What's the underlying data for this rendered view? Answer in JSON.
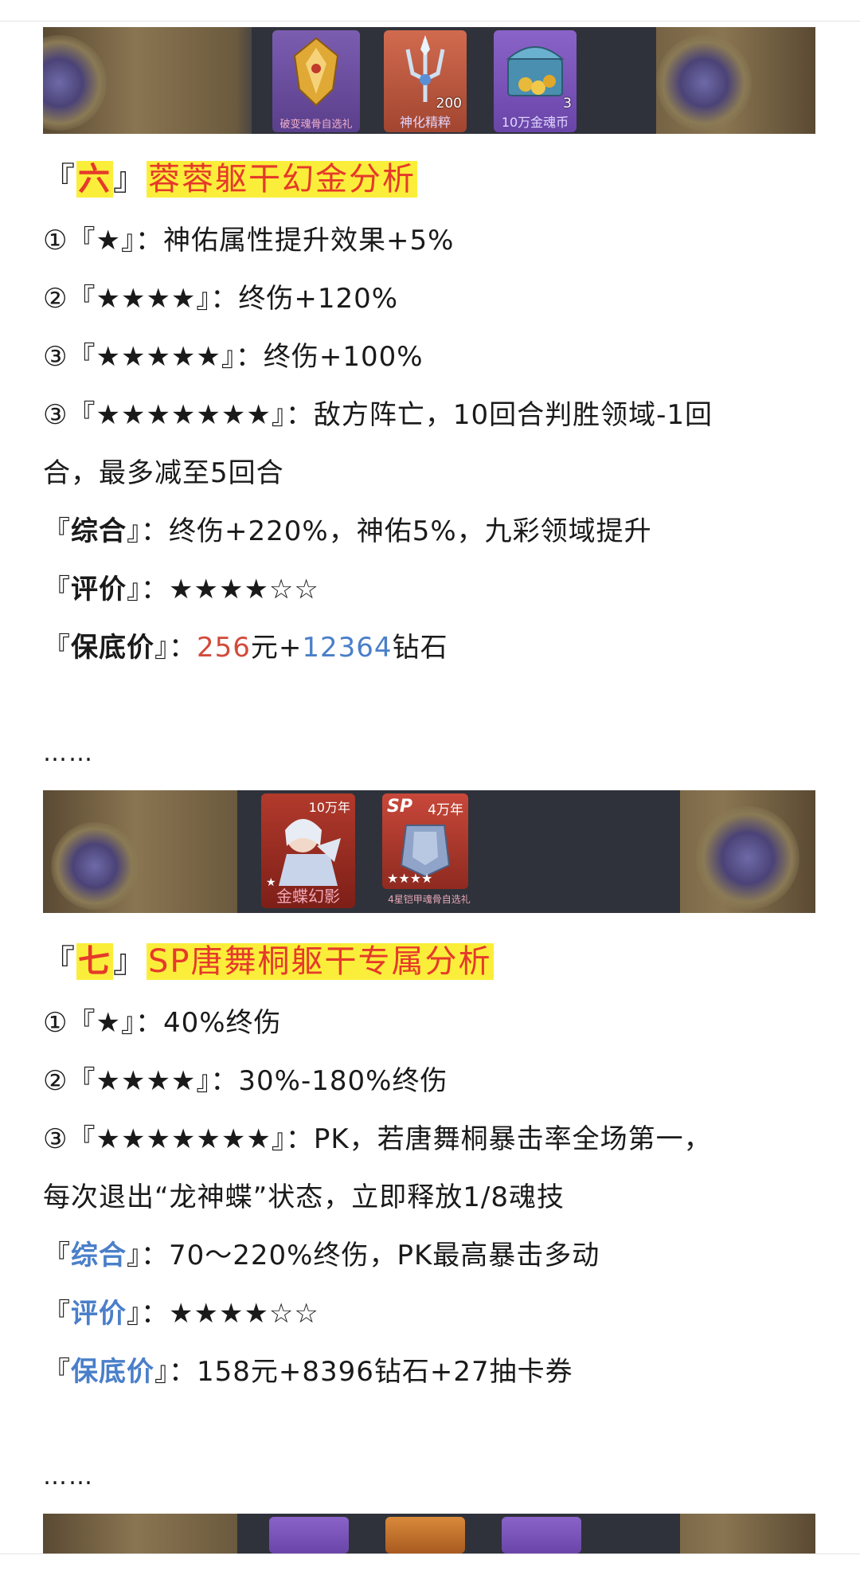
{
  "banner1": {
    "items": [
      {
        "caption": "破变魂骨自选礼",
        "count": "",
        "icon": "golden-mask-icon"
      },
      {
        "caption": "神化精粹",
        "count": "200",
        "icon": "trident-crystal-icon"
      },
      {
        "caption": "10万金魂币",
        "count": "3",
        "icon": "treasure-chest-icon"
      }
    ]
  },
  "section6": {
    "open": "『",
    "num": "六",
    "close": "』",
    "title": "蓉蓉躯干幻金分析",
    "lines": [
      {
        "marker": "①『★』：",
        "text": "神佑属性提升效果+5%"
      },
      {
        "marker": "②『★★★★』：",
        "text": "终伤+120%"
      },
      {
        "marker": "③『★★★★★』：",
        "text": "终伤+100%"
      },
      {
        "marker": "③『★★★★★★★』：",
        "text": "敌方阵亡，10回合判胜领域-1回"
      }
    ],
    "wrap": "合，最多减至5回合",
    "summary": {
      "open": "『",
      "label": "综合",
      "close": "』：",
      "text": "终伤+220%，神佑5%，九彩领域提升"
    },
    "rating": {
      "open": "『",
      "label": "评价",
      "close": "』：",
      "text": "★★★★☆☆"
    },
    "price": {
      "open": "『",
      "label": "保底价",
      "close": "』：",
      "rmb": "256",
      "unit1": "元+",
      "diamonds": "12364",
      "unit2": "钻石"
    }
  },
  "ellipsis1": "……",
  "banner2": {
    "items": [
      {
        "caption": "金蝶幻影",
        "tag": "10万年",
        "stars": "★",
        "icon": "hero-portrait-icon"
      },
      {
        "caption": "4星铠甲魂骨自选礼",
        "tag": "4万年",
        "badge": "SP",
        "stars": "★★★★",
        "icon": "armor-icon"
      }
    ]
  },
  "section7": {
    "open": "『",
    "num": "七",
    "close": "』",
    "title": "SP唐舞桐躯干专属分析",
    "lines": [
      {
        "marker": "①『★』：",
        "text": "40%终伤"
      },
      {
        "marker": "②『★★★★』：",
        "text": "30%-180%终伤"
      },
      {
        "marker": "③『★★★★★★★』：",
        "text": "PK，若唐舞桐暴击率全场第一，"
      }
    ],
    "wrap": "每次退出“龙神蝶”状态，立即释放1/8魂技",
    "summary": {
      "open": "『",
      "label": "综合",
      "close": "』：",
      "text": "70～220%终伤，PK最高暴击多动"
    },
    "rating": {
      "open": "『",
      "label": "评价",
      "close": "』：",
      "text": "★★★★☆☆"
    },
    "price": {
      "open": "『",
      "label": "保底价",
      "close": "』：",
      "text": "158元+8396钻石+27抽卡券"
    }
  },
  "ellipsis2": "……",
  "colors": {
    "highlight": "#fbee3a",
    "title_red": "#e53a2a",
    "blue": "#4a7fc9",
    "price_red": "#d24a3a"
  }
}
